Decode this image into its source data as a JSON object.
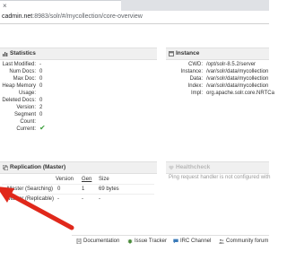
{
  "browser": {
    "close_glyph": "×",
    "url_host": "cadmin.net",
    "url_path": ":8983/solr/#/mycollection/core-overview"
  },
  "statistics": {
    "title": "Statistics",
    "rows": [
      {
        "key": "Last Modified:",
        "value": "-"
      },
      {
        "key": "Num Docs:",
        "value": "0"
      },
      {
        "key": "Max Doc:",
        "value": "0"
      },
      {
        "key": "Heap Memory",
        "value": "0"
      },
      {
        "key": "Usage:",
        "value": ""
      },
      {
        "key": "Deleted Docs:",
        "value": "0"
      },
      {
        "key": "Version:",
        "value": "2"
      },
      {
        "key": "Segment",
        "value": "0"
      },
      {
        "key": "Count:",
        "value": ""
      },
      {
        "key": "Current:",
        "value": "✔"
      }
    ]
  },
  "instance": {
    "title": "Instance",
    "rows": [
      {
        "key": "CWD:",
        "value": "/opt/solr-8.5.2/server"
      },
      {
        "key": "Instance:",
        "value": "/var/solr/data/mycollection"
      },
      {
        "key": "Data:",
        "value": "/var/solr/data/mycollection"
      },
      {
        "key": "Index:",
        "value": "/var/solr/data/mycollection"
      },
      {
        "key": "Impl:",
        "value": "org.apache.solr.core.NRTCa"
      }
    ]
  },
  "replication": {
    "title": "Replication (Master)",
    "columns": {
      "version": "Version",
      "gen": "Gen",
      "size": "Size"
    },
    "rows": [
      {
        "label": "Master (Searching)",
        "version": "0",
        "gen": "1",
        "size": "69 bytes"
      },
      {
        "label": "Master (Replicable)",
        "version": "-",
        "gen": "-",
        "size": "-"
      }
    ]
  },
  "healthcheck": {
    "title": "Healthcheck",
    "message": "Ping request handler is not configured with"
  },
  "footer": {
    "links": [
      {
        "label": "Documentation",
        "icon": "document-icon"
      },
      {
        "label": "Issue Tracker",
        "icon": "bug-icon"
      },
      {
        "label": "IRC Channel",
        "icon": "chat-icon"
      },
      {
        "label": "Community forum",
        "icon": "people-icon"
      }
    ]
  },
  "colors": {
    "check_green": "#3a9f3a",
    "annotation_arrow": "#e0281b"
  }
}
